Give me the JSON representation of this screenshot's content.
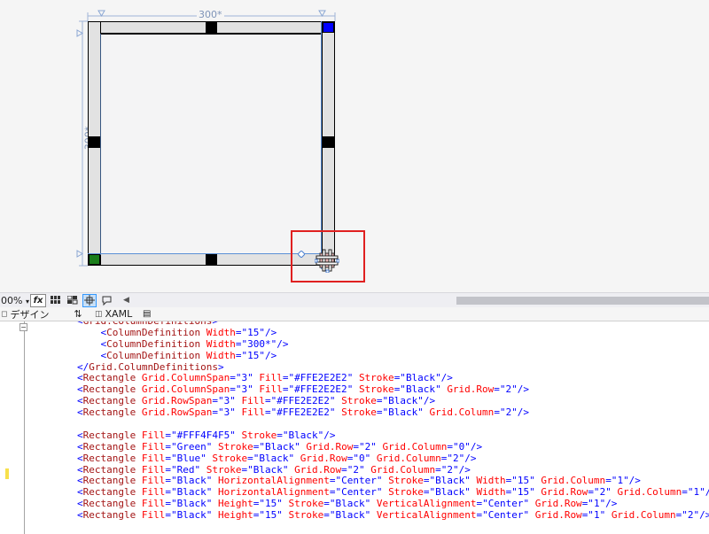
{
  "designer": {
    "width_dim_label": "300*",
    "height_dim_label": "300*",
    "colors": {
      "cell_fill": "#e2e2e2",
      "center_fill": "#f4f4f5",
      "green": "#1a7d1a",
      "blue": "#0000ff",
      "selection": "#5b8fd6",
      "highlight": "#e02020"
    }
  },
  "toolbar": {
    "zoom": "00%",
    "fx_label": "fx",
    "icons": [
      "grid-icon",
      "snap-grid-icon",
      "snap-lines-icon",
      "annotation-icon"
    ]
  },
  "tabs": {
    "design": "デザイン",
    "xaml": "XAML"
  },
  "code_lines": [
    [
      [
        "br",
        "<"
      ],
      [
        "tag",
        "Grid.ColumnDefinitions"
      ],
      [
        "br",
        ">"
      ]
    ],
    [
      [
        "sp",
        "    "
      ],
      [
        "br",
        "<"
      ],
      [
        "tag",
        "ColumnDefinition"
      ],
      [
        "sp",
        " "
      ],
      [
        "attr",
        "Width"
      ],
      [
        "br",
        "=\""
      ],
      [
        "val",
        "15"
      ],
      [
        "br",
        "\"/>"
      ]
    ],
    [
      [
        "sp",
        "    "
      ],
      [
        "br",
        "<"
      ],
      [
        "tag",
        "ColumnDefinition"
      ],
      [
        "sp",
        " "
      ],
      [
        "attr",
        "Width"
      ],
      [
        "br",
        "=\""
      ],
      [
        "val",
        "300*"
      ],
      [
        "br",
        "\"/>"
      ]
    ],
    [
      [
        "sp",
        "    "
      ],
      [
        "br",
        "<"
      ],
      [
        "tag",
        "ColumnDefinition"
      ],
      [
        "sp",
        " "
      ],
      [
        "attr",
        "Width"
      ],
      [
        "br",
        "=\""
      ],
      [
        "val",
        "15"
      ],
      [
        "br",
        "\"/>"
      ]
    ],
    [
      [
        "br",
        "</"
      ],
      [
        "tag",
        "Grid.ColumnDefinitions"
      ],
      [
        "br",
        ">"
      ]
    ],
    [
      [
        "br",
        "<"
      ],
      [
        "tag",
        "Rectangle"
      ],
      [
        "sp",
        " "
      ],
      [
        "attr",
        "Grid.ColumnSpan"
      ],
      [
        "br",
        "=\""
      ],
      [
        "val",
        "3"
      ],
      [
        "br",
        "\""
      ],
      [
        "sp",
        " "
      ],
      [
        "attr",
        "Fill"
      ],
      [
        "br",
        "=\""
      ],
      [
        "val",
        "#FFE2E2E2"
      ],
      [
        "br",
        "\""
      ],
      [
        "sp",
        " "
      ],
      [
        "attr",
        "Stroke"
      ],
      [
        "br",
        "=\""
      ],
      [
        "val",
        "Black"
      ],
      [
        "br",
        "\"/>"
      ]
    ],
    [
      [
        "br",
        "<"
      ],
      [
        "tag",
        "Rectangle"
      ],
      [
        "sp",
        " "
      ],
      [
        "attr",
        "Grid.ColumnSpan"
      ],
      [
        "br",
        "=\""
      ],
      [
        "val",
        "3"
      ],
      [
        "br",
        "\""
      ],
      [
        "sp",
        " "
      ],
      [
        "attr",
        "Fill"
      ],
      [
        "br",
        "=\""
      ],
      [
        "val",
        "#FFE2E2E2"
      ],
      [
        "br",
        "\""
      ],
      [
        "sp",
        " "
      ],
      [
        "attr",
        "Stroke"
      ],
      [
        "br",
        "=\""
      ],
      [
        "val",
        "Black"
      ],
      [
        "br",
        "\""
      ],
      [
        "sp",
        " "
      ],
      [
        "attr",
        "Grid.Row"
      ],
      [
        "br",
        "=\""
      ],
      [
        "val",
        "2"
      ],
      [
        "br",
        "\"/>"
      ]
    ],
    [
      [
        "br",
        "<"
      ],
      [
        "tag",
        "Rectangle"
      ],
      [
        "sp",
        " "
      ],
      [
        "attr",
        "Grid.RowSpan"
      ],
      [
        "br",
        "=\""
      ],
      [
        "val",
        "3"
      ],
      [
        "br",
        "\""
      ],
      [
        "sp",
        " "
      ],
      [
        "attr",
        "Fill"
      ],
      [
        "br",
        "=\""
      ],
      [
        "val",
        "#FFE2E2E2"
      ],
      [
        "br",
        "\""
      ],
      [
        "sp",
        " "
      ],
      [
        "attr",
        "Stroke"
      ],
      [
        "br",
        "=\""
      ],
      [
        "val",
        "Black"
      ],
      [
        "br",
        "\"/>"
      ]
    ],
    [
      [
        "br",
        "<"
      ],
      [
        "tag",
        "Rectangle"
      ],
      [
        "sp",
        " "
      ],
      [
        "attr",
        "Grid.RowSpan"
      ],
      [
        "br",
        "=\""
      ],
      [
        "val",
        "3"
      ],
      [
        "br",
        "\""
      ],
      [
        "sp",
        " "
      ],
      [
        "attr",
        "Fill"
      ],
      [
        "br",
        "=\""
      ],
      [
        "val",
        "#FFE2E2E2"
      ],
      [
        "br",
        "\""
      ],
      [
        "sp",
        " "
      ],
      [
        "attr",
        "Stroke"
      ],
      [
        "br",
        "=\""
      ],
      [
        "val",
        "Black"
      ],
      [
        "br",
        "\""
      ],
      [
        "sp",
        " "
      ],
      [
        "attr",
        "Grid.Column"
      ],
      [
        "br",
        "=\""
      ],
      [
        "val",
        "2"
      ],
      [
        "br",
        "\"/>"
      ]
    ],
    [],
    [
      [
        "br",
        "<"
      ],
      [
        "tag",
        "Rectangle"
      ],
      [
        "sp",
        " "
      ],
      [
        "attr",
        "Fill"
      ],
      [
        "br",
        "=\""
      ],
      [
        "val",
        "#FFF4F4F5"
      ],
      [
        "br",
        "\""
      ],
      [
        "sp",
        " "
      ],
      [
        "attr",
        "Stroke"
      ],
      [
        "br",
        "=\""
      ],
      [
        "val",
        "Black"
      ],
      [
        "br",
        "\"/>"
      ]
    ],
    [
      [
        "br",
        "<"
      ],
      [
        "tag",
        "Rectangle"
      ],
      [
        "sp",
        " "
      ],
      [
        "attr",
        "Fill"
      ],
      [
        "br",
        "=\""
      ],
      [
        "val",
        "Green"
      ],
      [
        "br",
        "\""
      ],
      [
        "sp",
        " "
      ],
      [
        "attr",
        "Stroke"
      ],
      [
        "br",
        "=\""
      ],
      [
        "val",
        "Black"
      ],
      [
        "br",
        "\""
      ],
      [
        "sp",
        " "
      ],
      [
        "attr",
        "Grid.Row"
      ],
      [
        "br",
        "=\""
      ],
      [
        "val",
        "2"
      ],
      [
        "br",
        "\""
      ],
      [
        "sp",
        " "
      ],
      [
        "attr",
        "Grid.Column"
      ],
      [
        "br",
        "=\""
      ],
      [
        "val",
        "0"
      ],
      [
        "br",
        "\"/>"
      ]
    ],
    [
      [
        "br",
        "<"
      ],
      [
        "tag",
        "Rectangle"
      ],
      [
        "sp",
        " "
      ],
      [
        "attr",
        "Fill"
      ],
      [
        "br",
        "=\""
      ],
      [
        "val",
        "Blue"
      ],
      [
        "br",
        "\""
      ],
      [
        "sp",
        " "
      ],
      [
        "attr",
        "Stroke"
      ],
      [
        "br",
        "=\""
      ],
      [
        "val",
        "Black"
      ],
      [
        "br",
        "\""
      ],
      [
        "sp",
        " "
      ],
      [
        "attr",
        "Grid.Row"
      ],
      [
        "br",
        "=\""
      ],
      [
        "val",
        "0"
      ],
      [
        "br",
        "\""
      ],
      [
        "sp",
        " "
      ],
      [
        "attr",
        "Grid.Column"
      ],
      [
        "br",
        "=\""
      ],
      [
        "val",
        "2"
      ],
      [
        "br",
        "\"/>"
      ]
    ],
    [
      [
        "br",
        "<"
      ],
      [
        "tag",
        "Rectangle"
      ],
      [
        "sp",
        " "
      ],
      [
        "attr",
        "Fill"
      ],
      [
        "br",
        "=\""
      ],
      [
        "val",
        "Red"
      ],
      [
        "br",
        "\""
      ],
      [
        "sp",
        " "
      ],
      [
        "attr",
        "Stroke"
      ],
      [
        "br",
        "=\""
      ],
      [
        "val",
        "Black"
      ],
      [
        "br",
        "\""
      ],
      [
        "sp",
        " "
      ],
      [
        "attr",
        "Grid.Row"
      ],
      [
        "br",
        "=\""
      ],
      [
        "val",
        "2"
      ],
      [
        "br",
        "\""
      ],
      [
        "sp",
        " "
      ],
      [
        "attr",
        "Grid.Column"
      ],
      [
        "br",
        "=\""
      ],
      [
        "val",
        "2"
      ],
      [
        "br",
        "\"/>"
      ]
    ],
    [
      [
        "br",
        "<"
      ],
      [
        "tag",
        "Rectangle"
      ],
      [
        "sp",
        " "
      ],
      [
        "attr",
        "Fill"
      ],
      [
        "br",
        "=\""
      ],
      [
        "val",
        "Black"
      ],
      [
        "br",
        "\""
      ],
      [
        "sp",
        " "
      ],
      [
        "attr",
        "HorizontalAlignment"
      ],
      [
        "br",
        "=\""
      ],
      [
        "val",
        "Center"
      ],
      [
        "br",
        "\""
      ],
      [
        "sp",
        " "
      ],
      [
        "attr",
        "Stroke"
      ],
      [
        "br",
        "=\""
      ],
      [
        "val",
        "Black"
      ],
      [
        "br",
        "\""
      ],
      [
        "sp",
        " "
      ],
      [
        "attr",
        "Width"
      ],
      [
        "br",
        "=\""
      ],
      [
        "val",
        "15"
      ],
      [
        "br",
        "\""
      ],
      [
        "sp",
        " "
      ],
      [
        "attr",
        "Grid.Column"
      ],
      [
        "br",
        "=\""
      ],
      [
        "val",
        "1"
      ],
      [
        "br",
        "\"/>"
      ]
    ],
    [
      [
        "br",
        "<"
      ],
      [
        "tag",
        "Rectangle"
      ],
      [
        "sp",
        " "
      ],
      [
        "attr",
        "Fill"
      ],
      [
        "br",
        "=\""
      ],
      [
        "val",
        "Black"
      ],
      [
        "br",
        "\""
      ],
      [
        "sp",
        " "
      ],
      [
        "attr",
        "HorizontalAlignment"
      ],
      [
        "br",
        "=\""
      ],
      [
        "val",
        "Center"
      ],
      [
        "br",
        "\""
      ],
      [
        "sp",
        " "
      ],
      [
        "attr",
        "Stroke"
      ],
      [
        "br",
        "=\""
      ],
      [
        "val",
        "Black"
      ],
      [
        "br",
        "\""
      ],
      [
        "sp",
        " "
      ],
      [
        "attr",
        "Width"
      ],
      [
        "br",
        "=\""
      ],
      [
        "val",
        "15"
      ],
      [
        "br",
        "\""
      ],
      [
        "sp",
        " "
      ],
      [
        "attr",
        "Grid.Row"
      ],
      [
        "br",
        "=\""
      ],
      [
        "val",
        "2"
      ],
      [
        "br",
        "\""
      ],
      [
        "sp",
        " "
      ],
      [
        "attr",
        "Grid.Column"
      ],
      [
        "br",
        "=\""
      ],
      [
        "val",
        "1"
      ],
      [
        "br",
        "\"/>"
      ]
    ],
    [
      [
        "br",
        "<"
      ],
      [
        "tag",
        "Rectangle"
      ],
      [
        "sp",
        " "
      ],
      [
        "attr",
        "Fill"
      ],
      [
        "br",
        "=\""
      ],
      [
        "val",
        "Black"
      ],
      [
        "br",
        "\""
      ],
      [
        "sp",
        " "
      ],
      [
        "attr",
        "Height"
      ],
      [
        "br",
        "=\""
      ],
      [
        "val",
        "15"
      ],
      [
        "br",
        "\""
      ],
      [
        "sp",
        " "
      ],
      [
        "attr",
        "Stroke"
      ],
      [
        "br",
        "=\""
      ],
      [
        "val",
        "Black"
      ],
      [
        "br",
        "\""
      ],
      [
        "sp",
        " "
      ],
      [
        "attr",
        "VerticalAlignment"
      ],
      [
        "br",
        "=\""
      ],
      [
        "val",
        "Center"
      ],
      [
        "br",
        "\""
      ],
      [
        "sp",
        " "
      ],
      [
        "attr",
        "Grid.Row"
      ],
      [
        "br",
        "=\""
      ],
      [
        "val",
        "1"
      ],
      [
        "br",
        "\"/>"
      ]
    ],
    [
      [
        "br",
        "<"
      ],
      [
        "tag",
        "Rectangle"
      ],
      [
        "sp",
        " "
      ],
      [
        "attr",
        "Fill"
      ],
      [
        "br",
        "=\""
      ],
      [
        "val",
        "Black"
      ],
      [
        "br",
        "\""
      ],
      [
        "sp",
        " "
      ],
      [
        "attr",
        "Height"
      ],
      [
        "br",
        "=\""
      ],
      [
        "val",
        "15"
      ],
      [
        "br",
        "\""
      ],
      [
        "sp",
        " "
      ],
      [
        "attr",
        "Stroke"
      ],
      [
        "br",
        "=\""
      ],
      [
        "val",
        "Black"
      ],
      [
        "br",
        "\""
      ],
      [
        "sp",
        " "
      ],
      [
        "attr",
        "VerticalAlignment"
      ],
      [
        "br",
        "=\""
      ],
      [
        "val",
        "Center"
      ],
      [
        "br",
        "\""
      ],
      [
        "sp",
        " "
      ],
      [
        "attr",
        "Grid.Row"
      ],
      [
        "br",
        "=\""
      ],
      [
        "val",
        "1"
      ],
      [
        "br",
        "\""
      ],
      [
        "sp",
        " "
      ],
      [
        "attr",
        "Grid.Column"
      ],
      [
        "br",
        "=\""
      ],
      [
        "val",
        "2"
      ],
      [
        "br",
        "\"/>"
      ]
    ]
  ]
}
